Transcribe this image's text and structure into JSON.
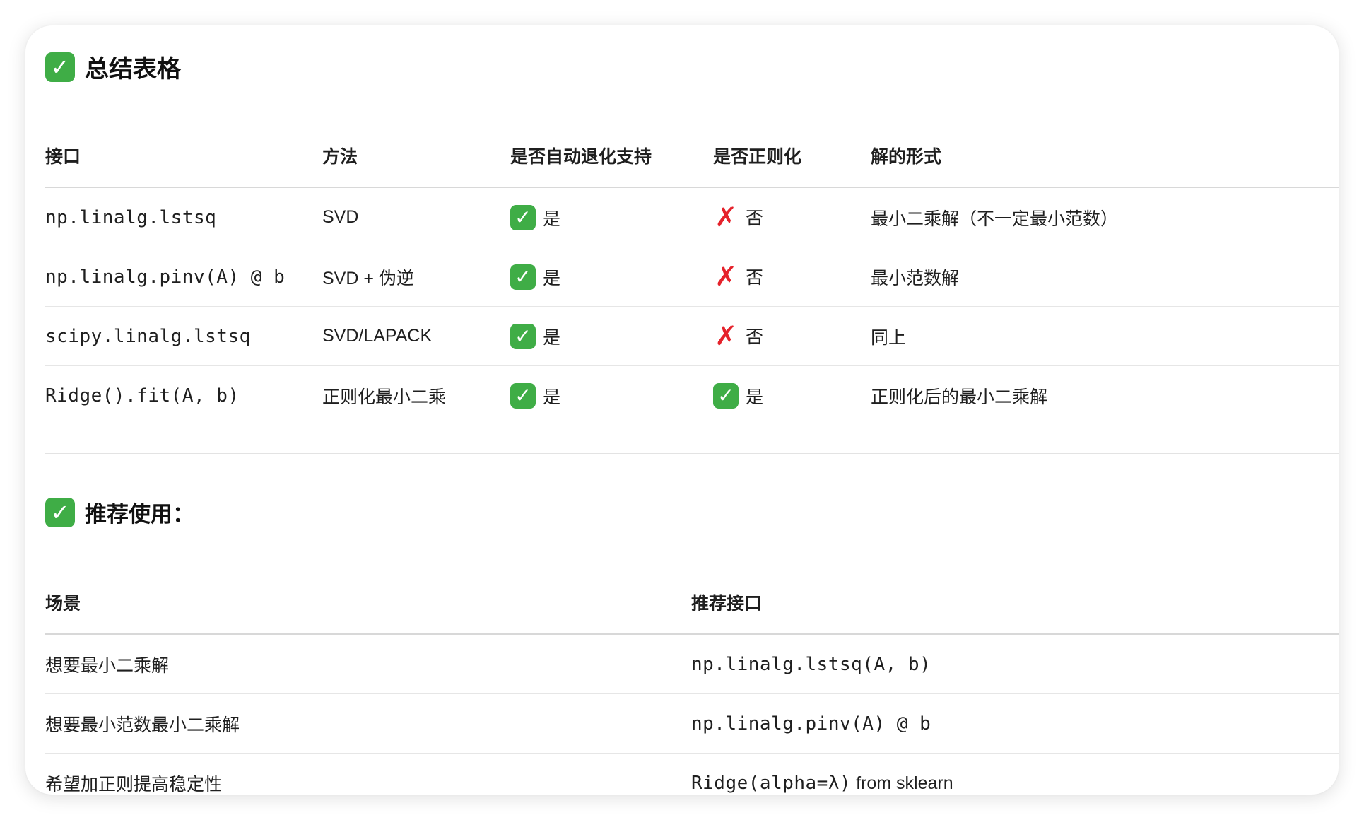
{
  "section1": {
    "title": "总结表格",
    "headers": [
      "接口",
      "方法",
      "是否自动退化支持",
      "是否正则化",
      "解的形式"
    ],
    "rows": [
      {
        "interface": "np.linalg.lstsq",
        "method": "SVD",
        "auto_degrade": "是",
        "auto_degrade_icon": "check-icon",
        "regularized": "否",
        "regularized_icon": "cross-icon",
        "solution": "最小二乘解（不一定最小范数）"
      },
      {
        "interface": "np.linalg.pinv(A) @ b",
        "method": "SVD + 伪逆",
        "auto_degrade": "是",
        "auto_degrade_icon": "check-icon",
        "regularized": "否",
        "regularized_icon": "cross-icon",
        "solution": "最小范数解"
      },
      {
        "interface": "scipy.linalg.lstsq",
        "method": "SVD/LAPACK",
        "auto_degrade": "是",
        "auto_degrade_icon": "check-icon",
        "regularized": "否",
        "regularized_icon": "cross-icon",
        "solution": "同上"
      },
      {
        "interface": "Ridge().fit(A, b)",
        "method": "正则化最小二乘",
        "auto_degrade": "是",
        "auto_degrade_icon": "check-icon",
        "regularized": "是",
        "regularized_icon": "check-icon",
        "solution": "正则化后的最小二乘解"
      }
    ]
  },
  "section2": {
    "title": "推荐使用：",
    "headers": [
      "场景",
      "推荐接口"
    ],
    "rows": [
      {
        "scenario": "想要最小二乘解",
        "interface": "np.linalg.lstsq(A, b)",
        "interface_suffix": ""
      },
      {
        "scenario": "想要最小范数最小二乘解",
        "interface": "np.linalg.pinv(A) @ b",
        "interface_suffix": ""
      },
      {
        "scenario": "希望加正则提高稳定性",
        "interface": "Ridge(alpha=λ)",
        "interface_suffix": " from sklearn"
      }
    ]
  },
  "colors": {
    "check": "#3fad46",
    "cross": "#e5222b"
  }
}
